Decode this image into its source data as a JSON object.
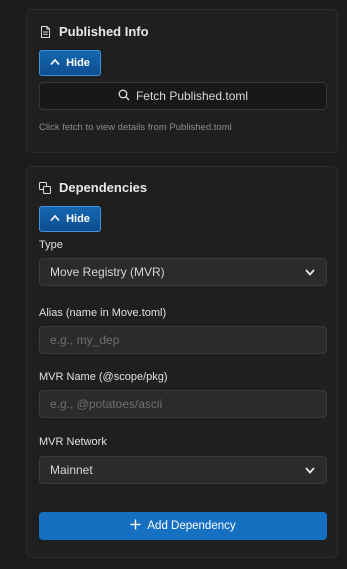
{
  "published": {
    "title": "Published Info",
    "title_icon": "document-icon",
    "hide_label": "Hide",
    "fetch_label": "Fetch Published.toml",
    "fetch_icon": "search-icon",
    "hint": "Click fetch to view details from Published.toml"
  },
  "dependencies": {
    "title": "Dependencies",
    "title_icon": "copy-icon",
    "hide_label": "Hide",
    "type_label": "Type",
    "type_value": "Move Registry (MVR)",
    "alias_label": "Alias (name in Move.toml)",
    "alias_value": "",
    "alias_placeholder": "e.g., my_dep",
    "mvr_name_label": "MVR Name (@scope/pkg)",
    "mvr_name_value": "",
    "mvr_name_placeholder": "e.g., @potatoes/ascii",
    "network_label": "MVR Network",
    "network_value": "Mainnet",
    "add_label": "Add Dependency",
    "add_icon": "plus-icon"
  },
  "colors": {
    "background": "#1c1c1c",
    "card": "#1f1f1f",
    "accent": "#1570c2",
    "hide_button": "#0d4f8f"
  }
}
